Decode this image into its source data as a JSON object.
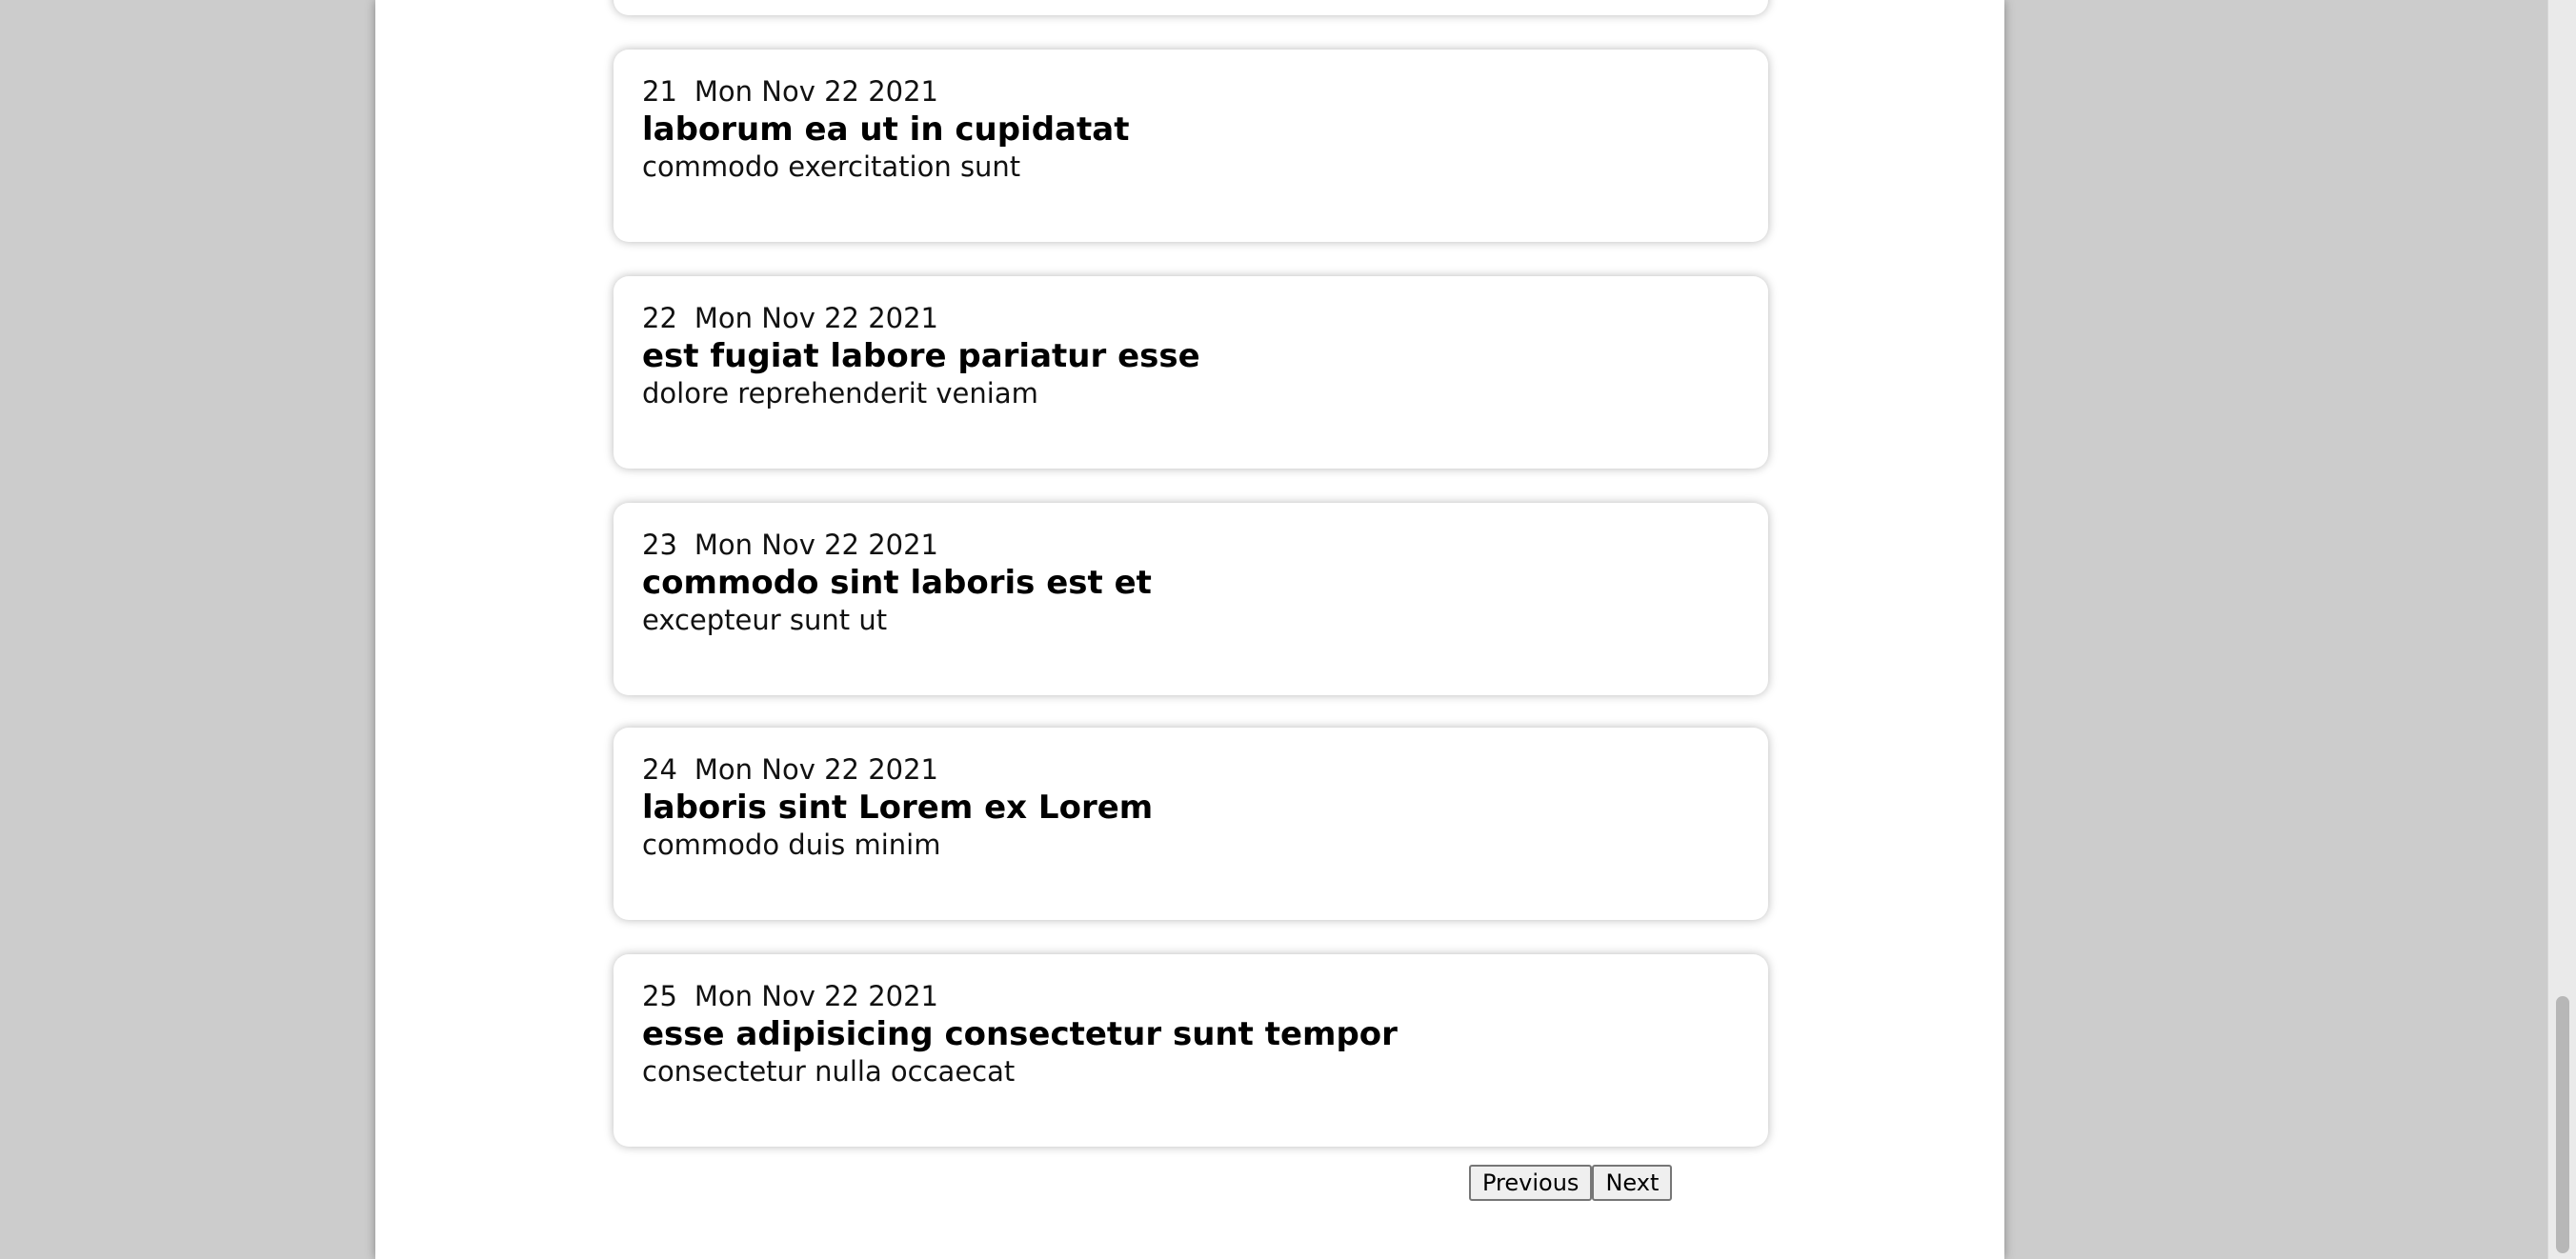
{
  "posts": [
    {
      "number": "21",
      "date": "Mon Nov 22 2021",
      "title": "laborum ea ut in cupidatat",
      "body": "commodo exercitation sunt"
    },
    {
      "number": "22",
      "date": "Mon Nov 22 2021",
      "title": "est fugiat labore pariatur esse",
      "body": "dolore reprehenderit veniam"
    },
    {
      "number": "23",
      "date": "Mon Nov 22 2021",
      "title": "commodo sint laboris est et",
      "body": "excepteur sunt ut"
    },
    {
      "number": "24",
      "date": "Mon Nov 22 2021",
      "title": "laboris sint Lorem ex Lorem",
      "body": "commodo duis minim"
    },
    {
      "number": "25",
      "date": "Mon Nov 22 2021",
      "title": "esse adipisicing consectetur sunt tempor",
      "body": "consectetur nulla occaecat"
    }
  ],
  "pagination": {
    "previous_label": "Previous",
    "next_label": "Next"
  }
}
